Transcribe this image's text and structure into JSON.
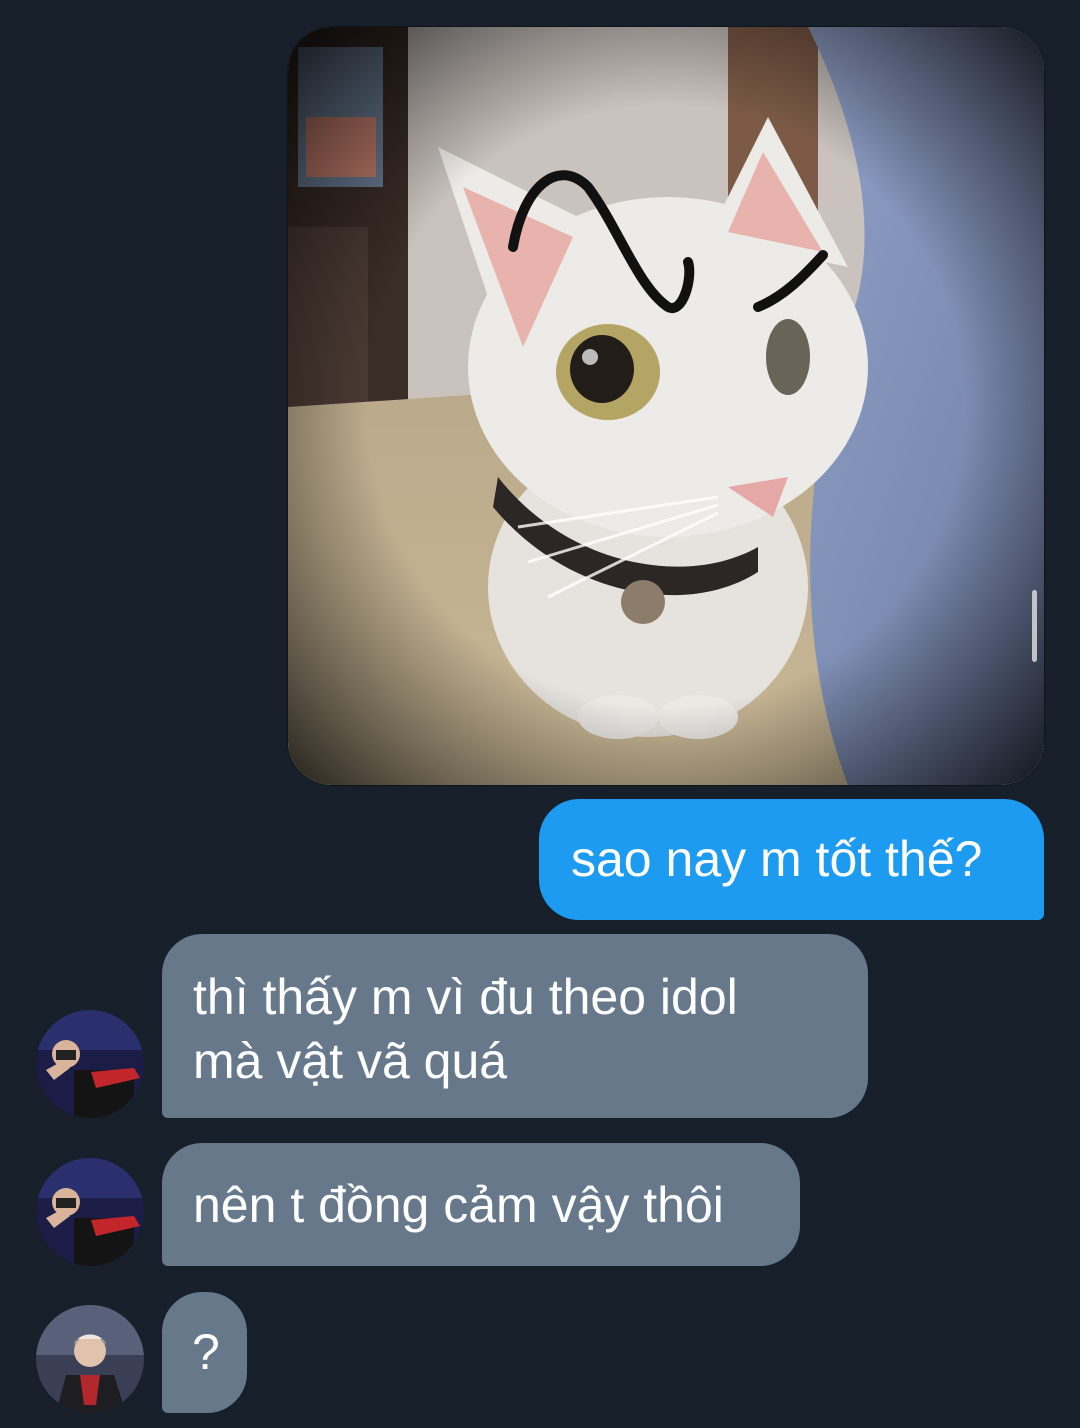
{
  "theme": {
    "background": "#161f2a",
    "outgoing_bubble": "#1d9bf0",
    "incoming_bubble": "#66788a",
    "text": "#ffffff"
  },
  "conversation": {
    "messages": [
      {
        "direction": "outgoing",
        "type": "image",
        "content": "photo of a white cat with doodled eyebrows"
      },
      {
        "direction": "outgoing",
        "type": "text",
        "lines": [
          "sao nay m tốt thế?"
        ]
      },
      {
        "direction": "incoming",
        "type": "text",
        "lines": [
          "thì thấy m vì đu theo idol",
          "mà vật vã quá"
        ]
      },
      {
        "direction": "incoming",
        "type": "text",
        "lines": [
          "nên t đồng cảm vậy thôi"
        ]
      },
      {
        "direction": "incoming",
        "type": "text",
        "lines": [
          "?"
        ]
      }
    ]
  },
  "icons": {
    "avatar_1": "person-avatar",
    "avatar_2": "person-avatar",
    "avatar_3": "person-avatar"
  }
}
